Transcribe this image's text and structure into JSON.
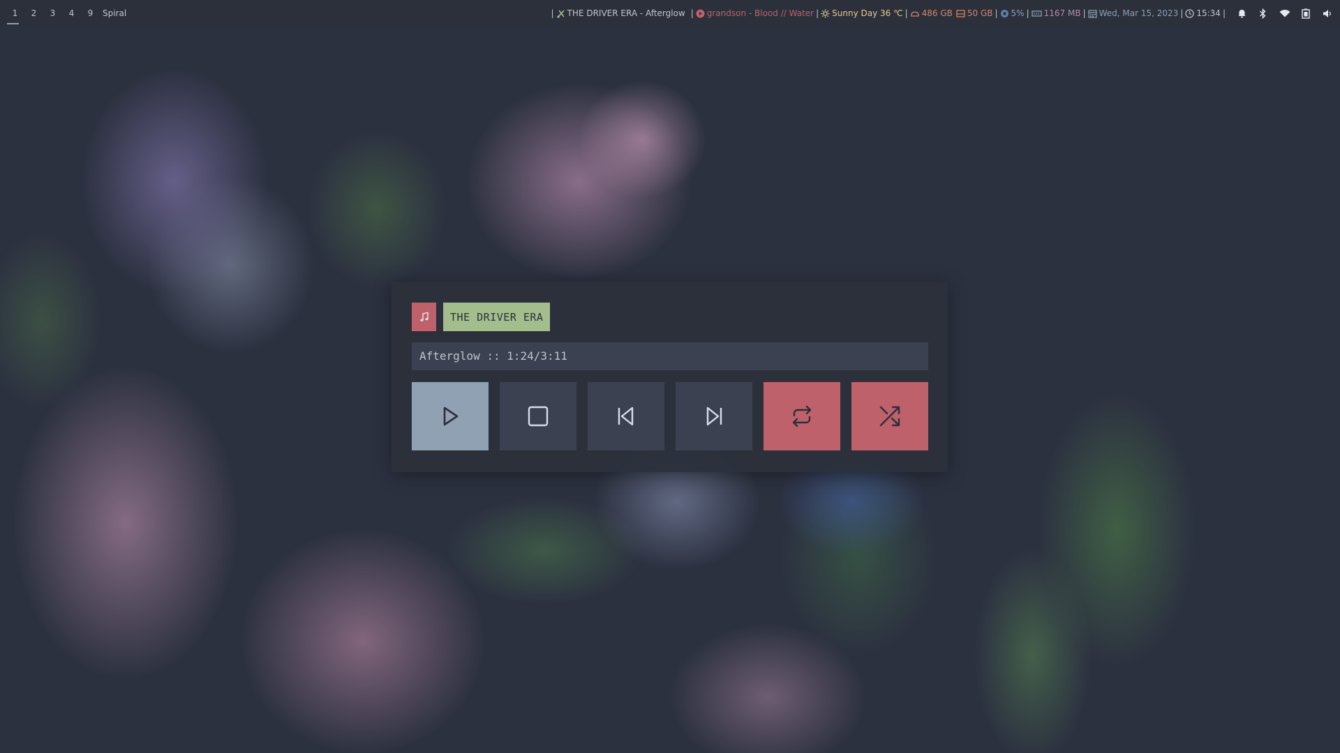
{
  "colors": {
    "bar_bg": "#2b303b",
    "fg": "#c0c5ce",
    "red": "#bf616a",
    "green": "#a3be8c",
    "yellow": "#ebcb8b",
    "blue": "#8fa1b3",
    "purple": "#b48ead",
    "widget_bg": "#2b303b",
    "button_bg": "#3b4150"
  },
  "topbar": {
    "workspaces": [
      "1",
      "2",
      "3",
      "4",
      "9"
    ],
    "active_workspace": "1",
    "layout": "Spiral",
    "modules": {
      "now_playing": {
        "icon": "music-icon",
        "text": "THE DRIVER ERA - Afterglow"
      },
      "youtube": {
        "icon": "youtube-icon",
        "text": "grandson - Blood // Water"
      },
      "weather": {
        "icon": "sun-icon",
        "text": "Sunny Day 36 ℃"
      },
      "disk_root": {
        "icon": "disk-icon",
        "text": "486 GB"
      },
      "disk_home": {
        "icon": "drive-icon",
        "text": "50 GB"
      },
      "cpu": {
        "icon": "cpu-icon",
        "text": "5%"
      },
      "memory": {
        "icon": "memory-icon",
        "text": "1167 MB"
      },
      "date": {
        "icon": "calendar-icon",
        "text": "Wed, Mar 15, 2023"
      },
      "time": {
        "icon": "clock-icon",
        "text": "15:34"
      }
    },
    "system_icons": [
      "bell-icon",
      "bluetooth-icon",
      "wifi-icon",
      "battery-icon",
      "volume-icon"
    ]
  },
  "player": {
    "icon": "music-note-icon",
    "artist": "THE DRIVER ERA",
    "track_line": "Afterglow :: 1:24/3:11",
    "controls": [
      {
        "name": "play",
        "icon": "play-icon"
      },
      {
        "name": "stop",
        "icon": "stop-icon"
      },
      {
        "name": "previous",
        "icon": "skip-back-icon"
      },
      {
        "name": "next",
        "icon": "skip-forward-icon"
      },
      {
        "name": "repeat",
        "icon": "repeat-icon"
      },
      {
        "name": "shuffle",
        "icon": "shuffle-icon"
      }
    ]
  }
}
